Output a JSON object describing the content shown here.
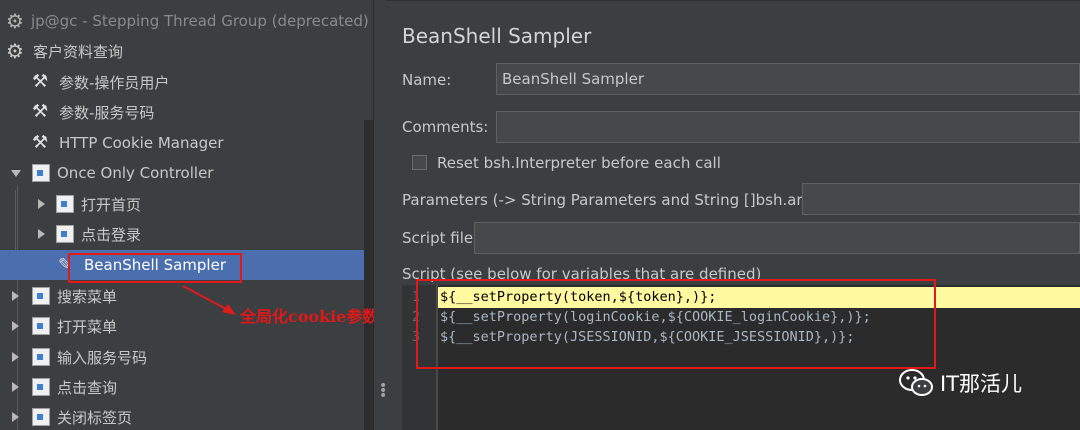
{
  "tree": {
    "items": [
      {
        "label": "jp@gc - Stepping Thread Group (deprecated)",
        "icon": "gear-icon",
        "muted": true
      },
      {
        "label": "客户资料查询",
        "icon": "gear-icon"
      },
      {
        "label": "参数-操作员用户",
        "icon": "wrench-icon"
      },
      {
        "label": "参数-服务号码",
        "icon": "wrench-icon"
      },
      {
        "label": "HTTP Cookie Manager",
        "icon": "wrench-icon"
      },
      {
        "label": "Once Only Controller",
        "icon": "controller-icon",
        "expanded": true
      },
      {
        "label": "打开首页",
        "icon": "controller-icon"
      },
      {
        "label": "点击登录",
        "icon": "controller-icon"
      },
      {
        "label": "BeanShell Sampler",
        "icon": "pencil-icon",
        "selected": true
      },
      {
        "label": "搜索菜单",
        "icon": "controller-icon"
      },
      {
        "label": "打开菜单",
        "icon": "controller-icon"
      },
      {
        "label": "输入服务号码",
        "icon": "controller-icon"
      },
      {
        "label": "点击查询",
        "icon": "controller-icon"
      },
      {
        "label": "关闭标签页",
        "icon": "controller-icon"
      }
    ]
  },
  "annotation": {
    "text": "全局化cookie参数",
    "color": "#e01818"
  },
  "panel": {
    "title": "BeanShell Sampler",
    "name_label": "Name:",
    "name_value": "BeanShell Sampler",
    "comments_label": "Comments:",
    "comments_value": "",
    "reset_label": "Reset bsh.Interpreter before each call",
    "params_label": "Parameters (-> String Parameters and String []bsh.args)",
    "params_value": "",
    "scriptfile_label": "Script file",
    "scriptfile_value": "",
    "script_label": "Script (see below for variables that are defined)"
  },
  "script": {
    "lines": [
      {
        "num": "1",
        "text": "${__setProperty(token,${token},)};"
      },
      {
        "num": "2",
        "text": "${__setProperty(loginCookie,${COOKIE_loginCookie},)};"
      },
      {
        "num": "3",
        "text": "${__setProperty(JSESSIONID,${COOKIE_JSESSIONID},)};"
      }
    ]
  },
  "watermark": {
    "text": "IT那活儿",
    "icon": "wechat-icon"
  },
  "colors": {
    "selection": "#4b6eaf",
    "highlight": "#fff9a0",
    "annotation_red": "#e0191b"
  }
}
